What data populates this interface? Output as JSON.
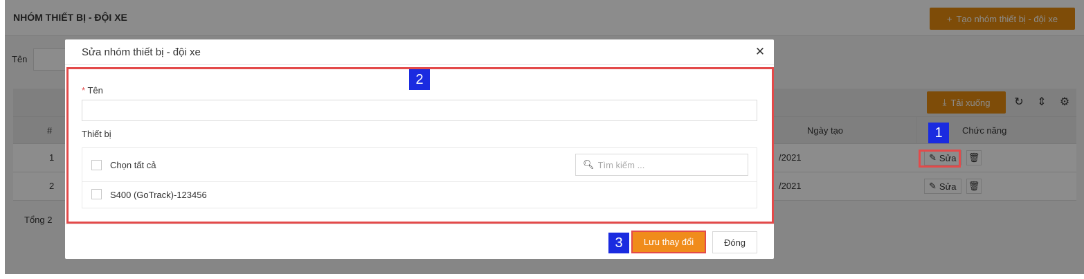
{
  "page": {
    "title": "NHÓM THIẾT BỊ - ĐỘI XE",
    "create_button": "Tạo nhóm thiết bị - đội xe",
    "filter_label": "Tên",
    "total": "Tổng 2"
  },
  "table": {
    "download_button": "Tải xuống",
    "columns": {
      "index": "#",
      "created": "Ngày tạo",
      "actions": "Chức năng"
    },
    "rows": [
      {
        "index": "1",
        "created": "/2021",
        "edit": "Sửa"
      },
      {
        "index": "2",
        "created": "/2021",
        "edit": "Sửa"
      }
    ]
  },
  "modal": {
    "title": "Sửa nhóm thiết bị - đội xe",
    "name_required_mark": "*",
    "name_label": "Tên",
    "name_value": "",
    "devices_label": "Thiết bị",
    "select_all": "Chọn tất cả",
    "search_placeholder": "Tìm kiếm ...",
    "devices": [
      "S400 (GoTrack)-123456"
    ],
    "save_button": "Lưu thay đổi",
    "close_button": "Đóng"
  },
  "markers": [
    "1",
    "2",
    "3"
  ],
  "colors": {
    "accent": "#e58b0f",
    "highlight": "#e34a4a",
    "marker": "#1a2be0"
  }
}
